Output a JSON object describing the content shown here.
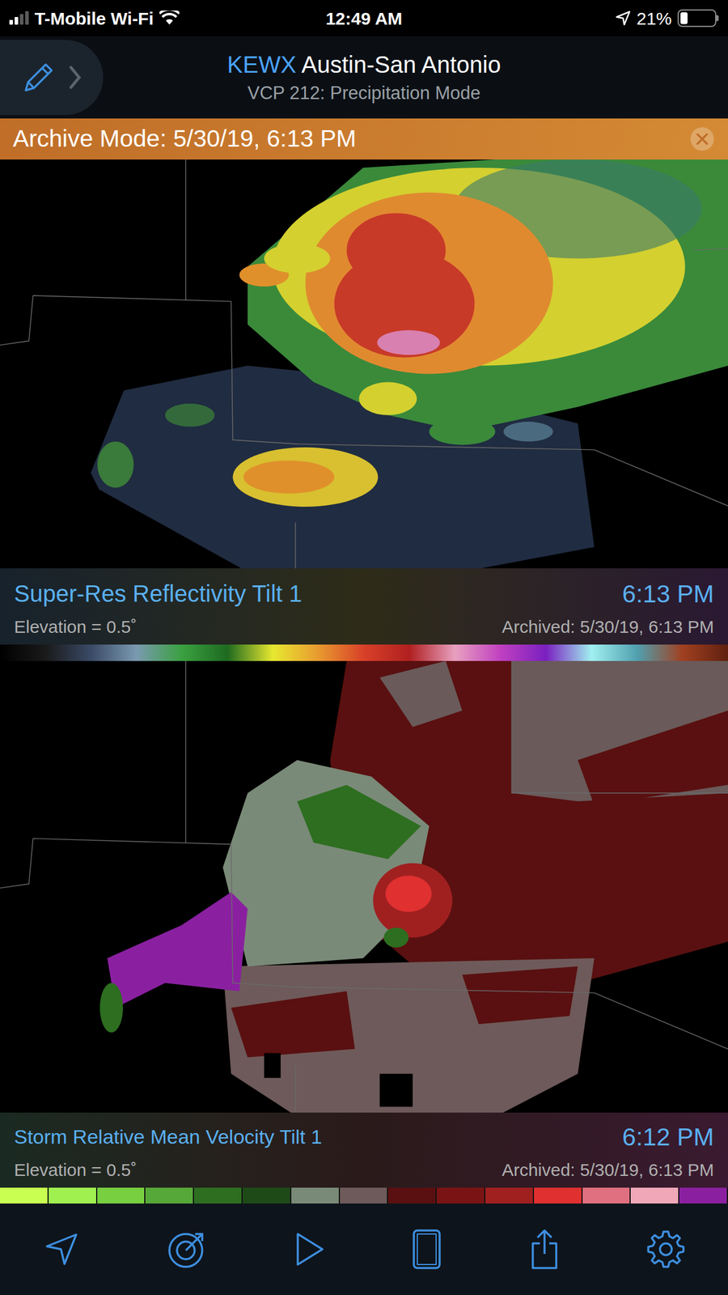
{
  "status_bar": {
    "carrier": "T-Mobile Wi-Fi",
    "time": "12:49 AM",
    "battery": "21%",
    "battery_level": 0.21,
    "signal": {
      "level": 0.5
    }
  },
  "header": {
    "station": "KEWX",
    "station_name": "Austin-San Antonio",
    "mode": "VCP 212: Precipitation Mode"
  },
  "archive_banner": {
    "text": "Archive Mode: 5/30/19, 6:13 PM"
  },
  "panels": [
    {
      "product": "Super-Res Reflectivity Tilt 1",
      "elevation": "Elevation = 0.5˚",
      "time": "6:13 PM",
      "archived": "Archived: 5/30/19, 6:13 PM",
      "scale": {
        "kind": "gradient",
        "colors": [
          "#000000",
          "#1a1a1a",
          "#3a4a66",
          "#7a9ab0",
          "#3aa040",
          "#1e6a20",
          "#e8e830",
          "#e89a30",
          "#d84028",
          "#b02020",
          "#e8a0c0",
          "#c040c0",
          "#7a20c0",
          "#a0f0f0",
          "#50a0b0",
          "#a04020",
          "#602010"
        ]
      }
    },
    {
      "product": "Storm Relative Mean Velocity Tilt 1",
      "elevation": "Elevation = 0.5˚",
      "time": "6:12 PM",
      "archived": "Archived: 5/30/19, 6:13 PM",
      "scale": {
        "kind": "steps",
        "colors": [
          "#c8ff50",
          "#a0f050",
          "#78d040",
          "#56a838",
          "#2d6e20",
          "#1e4a18",
          "#7a8a78",
          "#6e5a5a",
          "#5a1010",
          "#7a1414",
          "#a02020",
          "#e03030",
          "#e07080",
          "#f0a8b8",
          "#8a20a0"
        ]
      }
    }
  ]
}
